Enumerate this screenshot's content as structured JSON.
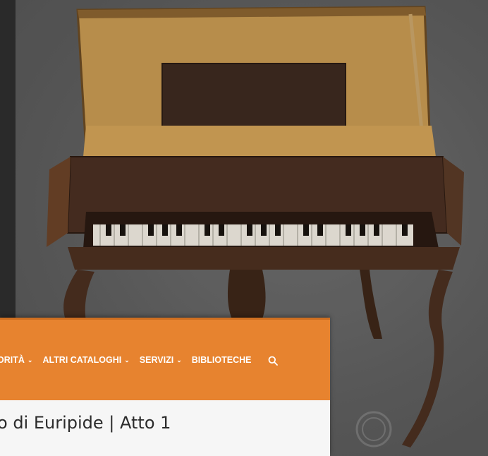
{
  "nav": {
    "items": [
      {
        "label": "ORITÀ",
        "chevron": true
      },
      {
        "label": "ALTRI CATALOGHI",
        "chevron": true
      },
      {
        "label": "SERVIZI",
        "chevron": true
      },
      {
        "label": "BIBLIOTECHE",
        "chevron": false
      }
    ],
    "chevron_glyph": "⌄",
    "search_icon": "search-icon"
  },
  "page": {
    "title": "o di Euripide | Atto 1"
  },
  "photo": {
    "subject": "piano-icon",
    "watermark_icon": "seal-icon"
  },
  "colors": {
    "nav_bg": "#e7832f",
    "title_bg": "#f6f6f6",
    "backdrop": "#262626"
  }
}
